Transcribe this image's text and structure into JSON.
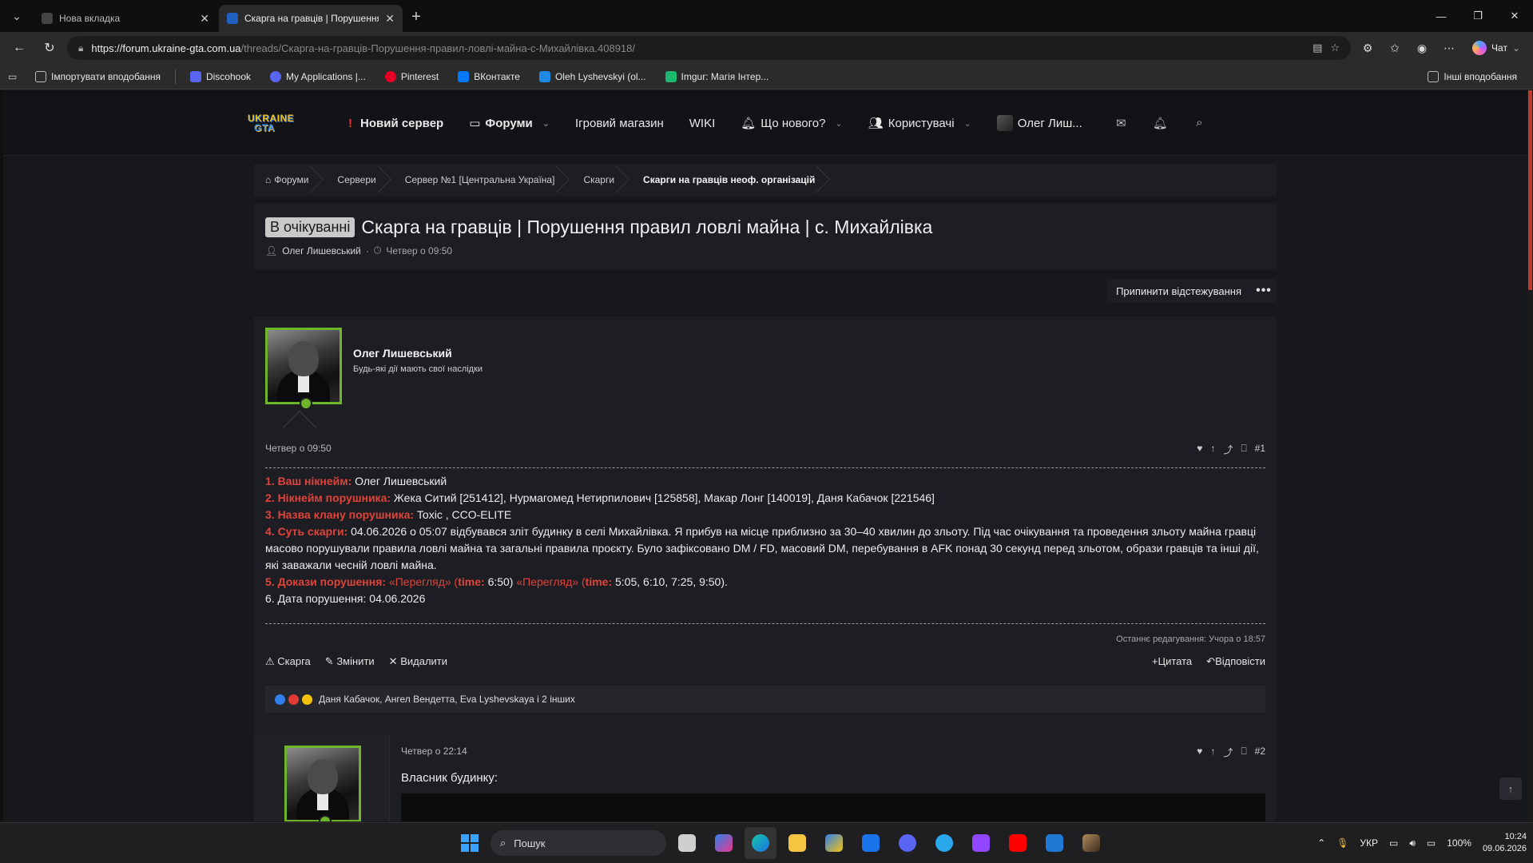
{
  "browser": {
    "tabs": [
      {
        "title": "Нова вкладка",
        "active": false
      },
      {
        "title": "Скарга на гравців | Порушення п",
        "active": true
      }
    ],
    "url_host": "https://forum.ukraine-gta.com.ua",
    "url_path": "/threads/Скарга-на-гравців-Порушення-правил-ловлі-майна-с-Михайлівка.408918/",
    "copilot_label": "Чат",
    "bookmarks": [
      {
        "label": "Імпортувати вподобання",
        "color": "#777777"
      },
      {
        "label": "Discohook",
        "color": "#5865f2"
      },
      {
        "label": "My Applications |...",
        "color": "#5865f2"
      },
      {
        "label": "Pinterest",
        "color": "#e60023"
      },
      {
        "label": "ВКонтакте",
        "color": "#0077ff"
      },
      {
        "label": "Oleh Lyshevskyi (ol...",
        "color": "#1e88e5"
      },
      {
        "label": "Imgur: Магія Інтер...",
        "color": "#1bb76e"
      }
    ],
    "other_bookmarks": "Інші вподобання"
  },
  "header": {
    "logo_line1": "UKRAINE",
    "logo_line2": "GTA",
    "nav": {
      "new_server": "Новий сервер",
      "forums": "Форуми",
      "shop": "Ігровий магазин",
      "wiki": "WIKI",
      "whats_new": "Що нового?",
      "users": "Користувачі",
      "account": "Олег Лиш..."
    }
  },
  "breadcrumb": [
    "Форуми",
    "Сервери",
    "Сервер №1 [Центральна Україна]",
    "Скарги",
    "Скарги на гравців неоф. організацій"
  ],
  "thread": {
    "prefix": "В очікуванні",
    "title": "Скарга на гравців | Порушення правил ловлі майна | с. Михайлівка",
    "author": "Олег Лишевський",
    "date": "Четвер о 09:50",
    "unwatch": "Припинити відстежування"
  },
  "post1": {
    "username": "Олег Лишевський",
    "user_title": "Будь-які дії мають свої наслідки",
    "date": "Четвер о 09:50",
    "number": "#1",
    "q1_label": "1. Ваш нікнейм:",
    "q1_value": "Олег Лишевський",
    "q2_label": "2. Нікнейм порушника:",
    "q2_value": "Жека Ситий [251412], Нурмагомед Нетирпилович [125858], Макар Лонг [140019], Даня Кабачок [221546]",
    "q3_label": "3. Назва клану порушника:",
    "q3_value": "Toxic , CCO-ELITE",
    "q4_label": "4. Суть скарги:",
    "q4_value": "04.06.2026 о 05:07 відбувався зліт будинку в селі Михайлівка. Я прибув на місце приблизно за 30–40 хвилин до зльоту. Під час очікування та проведення зльоту майна гравці масово порушували правила ловлі майна та загальні правила проєкту. Було зафіксовано DM / FD, масовий DM, перебування в AFK понад 30 секунд перед зльотом, образи гравців та інші дії, які заважали чесній ловлі майна.",
    "q5_label": "5. Докази порушення:",
    "q5_link1": "«Перегляд»",
    "q5_time_label": "time:",
    "q5_time1": "6:50)",
    "q5_link2": "«Перегляд»",
    "q5_time2": "5:05, 6:10, 7:25, 9:50).",
    "q6": "6. Дата порушення: 04.06.2026",
    "last_edit": "Останнє редагування: Учора о 18:57",
    "actions_left": [
      "Скарга",
      "Змінити",
      "Видалити"
    ],
    "actions_right": [
      "Цитата",
      "Відповісти"
    ],
    "reactions_text": "Даня Кабачок, Ангел Вендетта, Eva Lyshevskaya і 2 інших"
  },
  "post2": {
    "date": "Четвер о 22:14",
    "number": "#2",
    "text": "Власник будинку:"
  },
  "taskbar": {
    "search_placeholder": "Пошук",
    "lang": "УКР",
    "battery": "100%",
    "time": "10:24",
    "date": "09.06.2026"
  },
  "colors": {
    "accent_red": "#e0433a",
    "avatar_border": "#6fb52c"
  }
}
